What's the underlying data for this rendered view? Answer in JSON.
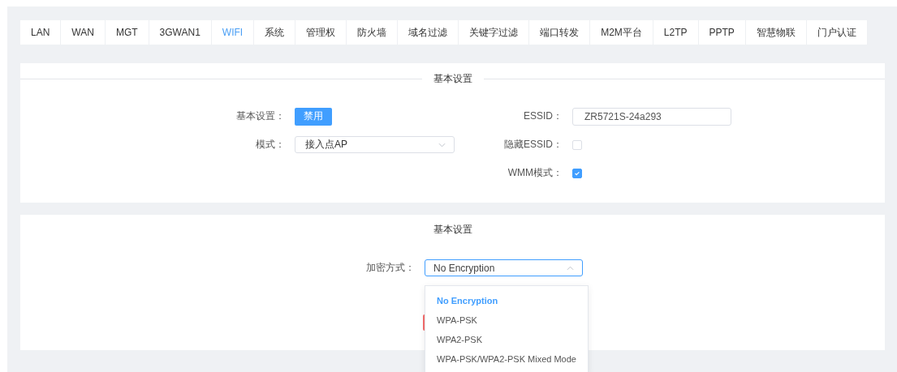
{
  "tabs": [
    {
      "label": "LAN",
      "selected": false
    },
    {
      "label": "WAN",
      "selected": false
    },
    {
      "label": "MGT",
      "selected": false
    },
    {
      "label": "3GWAN1",
      "selected": false
    },
    {
      "label": "WIFI",
      "selected": true
    },
    {
      "label": "系统",
      "selected": false
    },
    {
      "label": "管理权",
      "selected": false
    },
    {
      "label": "防火墙",
      "selected": false
    },
    {
      "label": "域名过滤",
      "selected": false
    },
    {
      "label": "关键字过滤",
      "selected": false
    },
    {
      "label": "端口转发",
      "selected": false
    },
    {
      "label": "M2M平台",
      "selected": false
    },
    {
      "label": "L2TP",
      "selected": false
    },
    {
      "label": "PPTP",
      "selected": false
    },
    {
      "label": "智慧物联",
      "selected": false
    },
    {
      "label": "门户认证",
      "selected": false
    }
  ],
  "basic_section": {
    "title": "基本设置",
    "enable": {
      "label": "基本设置：",
      "button": "禁用"
    },
    "essid": {
      "label": "ESSID：",
      "value": "ZR5721S-24a293"
    },
    "mode": {
      "label": "模式：",
      "value": "接入点AP"
    },
    "hide_essid": {
      "label": "隐藏ESSID：",
      "checked": false
    },
    "wmm": {
      "label": "WMM模式：",
      "checked": true
    }
  },
  "security_section": {
    "title": "基本设置",
    "encryption": {
      "label": "加密方式：",
      "value": "No Encryption",
      "expanded": true,
      "options": [
        {
          "label": "No Encryption",
          "selected": true
        },
        {
          "label": "WPA-PSK",
          "selected": false
        },
        {
          "label": "WPA2-PSK",
          "selected": false
        },
        {
          "label": "WPA-PSK/WPA2-PSK Mixed Mode",
          "selected": false
        }
      ]
    }
  }
}
